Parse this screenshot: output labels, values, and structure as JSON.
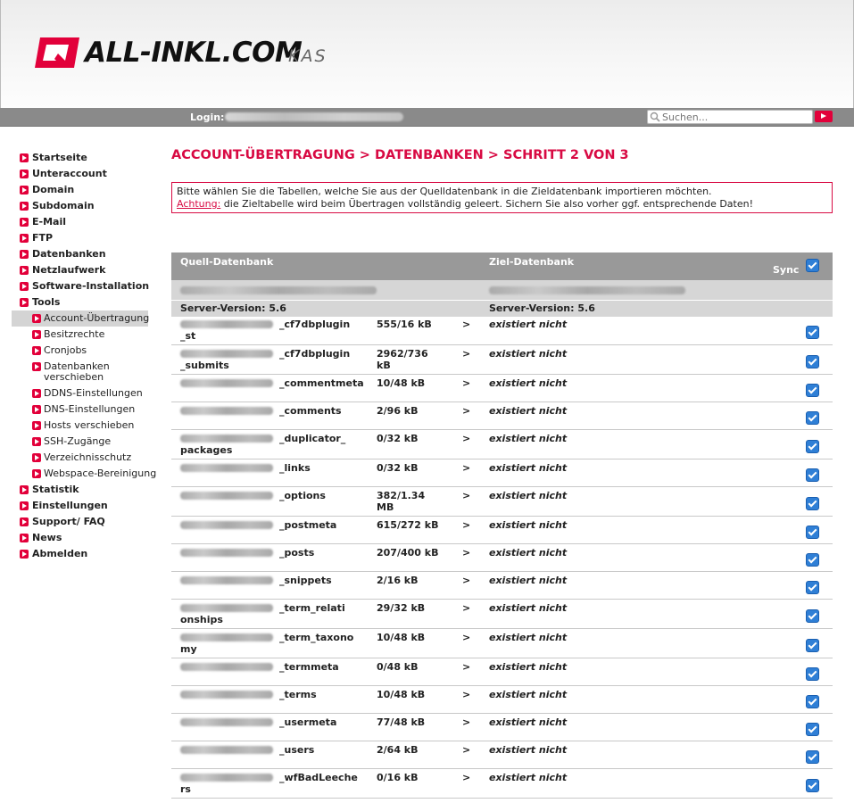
{
  "header": {
    "logo_text": "ALL-INKL.COM",
    "logo_suffix": "KAS",
    "login_label": "Login:"
  },
  "search": {
    "placeholder": "Suchen..."
  },
  "colors": {
    "brand_red": "#e2003a",
    "topbar_gray": "#8a8a8a",
    "checkbox_blue": "#2f7fd6"
  },
  "sidebar": {
    "items": [
      {
        "label": "Startseite"
      },
      {
        "label": "Unteraccount"
      },
      {
        "label": "Domain"
      },
      {
        "label": "Subdomain"
      },
      {
        "label": "E-Mail"
      },
      {
        "label": "FTP"
      },
      {
        "label": "Datenbanken"
      },
      {
        "label": "Netzlaufwerk"
      },
      {
        "label": "Software-Installation"
      },
      {
        "label": "Tools"
      }
    ],
    "tools_sub": [
      {
        "label": "Account-Übertragung"
      },
      {
        "label": "Besitzrechte"
      },
      {
        "label": "Cronjobs"
      },
      {
        "label": "Datenbanken verschieben",
        "l1": "Datenbanken",
        "l2": "verschieben"
      },
      {
        "label": "DDNS-Einstellungen"
      },
      {
        "label": "DNS-Einstellungen"
      },
      {
        "label": "Hosts verschieben"
      },
      {
        "label": "SSH-Zugänge"
      },
      {
        "label": "Verzeichnisschutz"
      },
      {
        "label": "Webspace-Bereinigung"
      }
    ],
    "items_after": [
      {
        "label": "Statistik"
      },
      {
        "label": "Einstellungen"
      },
      {
        "label": "Support/ FAQ"
      },
      {
        "label": "News"
      },
      {
        "label": "Abmelden"
      }
    ]
  },
  "main": {
    "title": "ACCOUNT-ÜBERTRAGUNG > DATENBANKEN > SCHRITT 2 VON 3",
    "notice_line1": "Bitte wählen Sie die Tabellen, welche Sie aus der Quelldatenbank in die Zieldatenbank importieren möchten.",
    "notice_link": "Achtung:",
    "notice_line2": " die Zieltabelle wird beim Übertragen vollständig geleert. Sichern Sie also vorher ggf. entsprechende Daten!"
  },
  "table": {
    "col_source": "Quell-Datenbank",
    "col_target": "Ziel-Datenbank",
    "col_sync": "Sync",
    "source_version": "Server-Version: 5.6",
    "target_version": "Server-Version: 5.6",
    "arrow": ">",
    "rows": [
      {
        "name1": "_cf7dbplugin",
        "name2": "_st",
        "size1": "555/16 kB",
        "size2": "",
        "status": "existiert nicht",
        "checked": true
      },
      {
        "name1": "_cf7dbplugin",
        "name2": "_submits",
        "size1": "2962/736",
        "size2": "kB",
        "status": "existiert nicht",
        "checked": true
      },
      {
        "name1": "_commentmeta",
        "name2": "",
        "size1": "10/48 kB",
        "size2": "",
        "status": "existiert nicht",
        "checked": true
      },
      {
        "name1": "_comments",
        "name2": "",
        "size1": "2/96 kB",
        "size2": "",
        "status": "existiert nicht",
        "checked": true
      },
      {
        "name1": "_duplicator_",
        "name2": "packages",
        "size1": "0/32 kB",
        "size2": "",
        "status": "existiert nicht",
        "checked": true
      },
      {
        "name1": "_links",
        "name2": "",
        "size1": "0/32 kB",
        "size2": "",
        "status": "existiert nicht",
        "checked": true
      },
      {
        "name1": "_options",
        "name2": "",
        "size1": "382/1.34",
        "size2": "MB",
        "status": "existiert nicht",
        "checked": true
      },
      {
        "name1": "_postmeta",
        "name2": "",
        "size1": "615/272 kB",
        "size2": "",
        "status": "existiert nicht",
        "checked": true
      },
      {
        "name1": "_posts",
        "name2": "",
        "size1": "207/400 kB",
        "size2": "",
        "status": "existiert nicht",
        "checked": true
      },
      {
        "name1": "_snippets",
        "name2": "",
        "size1": "2/16 kB",
        "size2": "",
        "status": "existiert nicht",
        "checked": true
      },
      {
        "name1": "_term_relati",
        "name2": "onships",
        "size1": "29/32 kB",
        "size2": "",
        "status": "existiert nicht",
        "checked": true
      },
      {
        "name1": "_term_taxono",
        "name2": "my",
        "size1": "10/48 kB",
        "size2": "",
        "status": "existiert nicht",
        "checked": true
      },
      {
        "name1": "_termmeta",
        "name2": "",
        "size1": "0/48 kB",
        "size2": "",
        "status": "existiert nicht",
        "checked": true
      },
      {
        "name1": "_terms",
        "name2": "",
        "size1": "10/48 kB",
        "size2": "",
        "status": "existiert nicht",
        "checked": true
      },
      {
        "name1": "_usermeta",
        "name2": "",
        "size1": "77/48 kB",
        "size2": "",
        "status": "existiert nicht",
        "checked": true
      },
      {
        "name1": "_users",
        "name2": "",
        "size1": "2/64 kB",
        "size2": "",
        "status": "existiert nicht",
        "checked": true
      },
      {
        "name1": "_wfBadLeeche",
        "name2": "rs",
        "size1": "0/16 kB",
        "size2": "",
        "status": "existiert nicht",
        "checked": true
      }
    ]
  }
}
